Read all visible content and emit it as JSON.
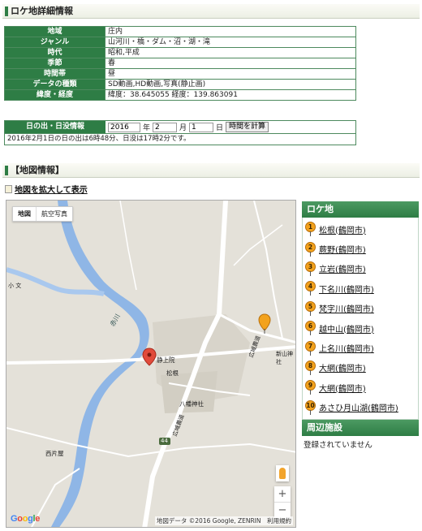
{
  "location_section": {
    "title": "ロケ地詳細情報",
    "rows": [
      {
        "label": "地域",
        "value": "庄内"
      },
      {
        "label": "ジャンル",
        "value": "山河川・橋・ダム・沼・湖・滝"
      },
      {
        "label": "時代",
        "value": "昭和,平成"
      },
      {
        "label": "季節",
        "value": "春"
      },
      {
        "label": "時間帯",
        "value": "昼"
      },
      {
        "label": "データの種類",
        "value": "SD動画,HD動画,写真(静止画)"
      },
      {
        "label": "緯度・経度",
        "value": "緯度：38.645055 経度：139.863091"
      }
    ]
  },
  "sun": {
    "label": "日の出・日没情報",
    "year": "2016",
    "year_unit": "年",
    "month": "2",
    "month_unit": "月",
    "day": "1",
    "day_unit": "日",
    "button": "時間を計算",
    "result": "2016年2月1日の日の出は6時48分、日没は17時2分です。"
  },
  "map_section": {
    "title": "【地図情報】",
    "enlarge_link": "地図を拡大して表示",
    "map_types": [
      "地図",
      "航空写真"
    ],
    "labels": {
      "river": "赤川",
      "place1": "静上院",
      "place2": "松根",
      "place3": "八幡神社",
      "place4": "西片屋",
      "place5": "新山神社",
      "road1": "広域農道",
      "road2": "広域農道",
      "route": "44",
      "school": "小 文",
      "google": "Google",
      "credit": "地図データ ©2016 Google, ZENRIN　利用規約"
    },
    "zoom_in": "+",
    "zoom_out": "−"
  },
  "sidebar": {
    "locations_title": "ロケ地",
    "locations": [
      {
        "num": "1",
        "name": "松根(鶴岡市)"
      },
      {
        "num": "2",
        "name": "蕨野(鶴岡市)"
      },
      {
        "num": "3",
        "name": "立岩(鶴岡市)"
      },
      {
        "num": "4",
        "name": "下名川(鶴岡市)"
      },
      {
        "num": "5",
        "name": "梵字川(鶴岡市)"
      },
      {
        "num": "6",
        "name": "越中山(鶴岡市)"
      },
      {
        "num": "7",
        "name": "上名川(鶴岡市)"
      },
      {
        "num": "8",
        "name": "大網(鶴岡市)"
      },
      {
        "num": "9",
        "name": "大網(鶴岡市)"
      },
      {
        "num": "10",
        "name": "あさひ月山湖(鶴岡市)"
      }
    ],
    "nearby_title": "周辺施設",
    "nearby_empty": "登録されていません"
  },
  "colors": {
    "accent": "#2e7d45",
    "pin": "#f3a21c",
    "river": "#8fb6e6"
  }
}
